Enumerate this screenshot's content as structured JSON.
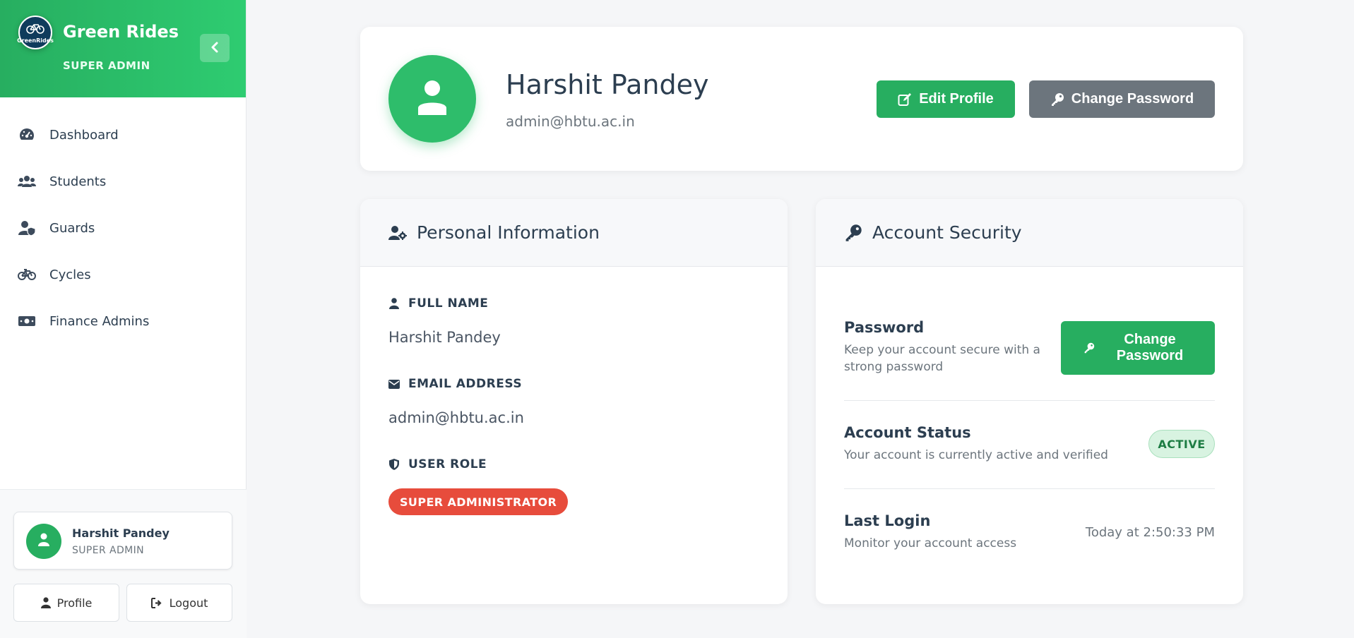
{
  "brand": {
    "title": "Green Rides",
    "subtitle": "SUPER ADMIN",
    "logo_text": "GreenRides",
    "accent_color": "#27ae60"
  },
  "sidebar": {
    "items": [
      {
        "label": "Dashboard",
        "icon": "tachometer-icon"
      },
      {
        "label": "Students",
        "icon": "users-icon"
      },
      {
        "label": "Guards",
        "icon": "user-shield-icon"
      },
      {
        "label": "Cycles",
        "icon": "bicycle-icon"
      },
      {
        "label": "Finance Admins",
        "icon": "money-bill-icon"
      }
    ],
    "user": {
      "name": "Harshit Pandey",
      "role": "SUPER ADMIN"
    },
    "profile_label": "Profile",
    "logout_label": "Logout"
  },
  "profile": {
    "name": "Harshit Pandey",
    "email": "admin@hbtu.ac.in",
    "edit_label": "Edit Profile",
    "change_password_label": "Change Password"
  },
  "personal_info": {
    "title": "Personal Information",
    "full_name_label": "FULL NAME",
    "full_name": "Harshit Pandey",
    "email_label": "EMAIL ADDRESS",
    "email": "admin@hbtu.ac.in",
    "role_label": "USER ROLE",
    "role": "SUPER ADMINISTRATOR",
    "role_color": "#e74c3c"
  },
  "security": {
    "title": "Account Security",
    "password_title": "Password",
    "password_desc": "Keep your account secure with a strong password",
    "change_password_label": "Change Password",
    "status_title": "Account Status",
    "status_desc": "Your account is currently active and verified",
    "status_badge": "ACTIVE",
    "login_title": "Last Login",
    "login_desc": "Monitor your account access",
    "login_time": "Today at 2:50:33 PM"
  }
}
